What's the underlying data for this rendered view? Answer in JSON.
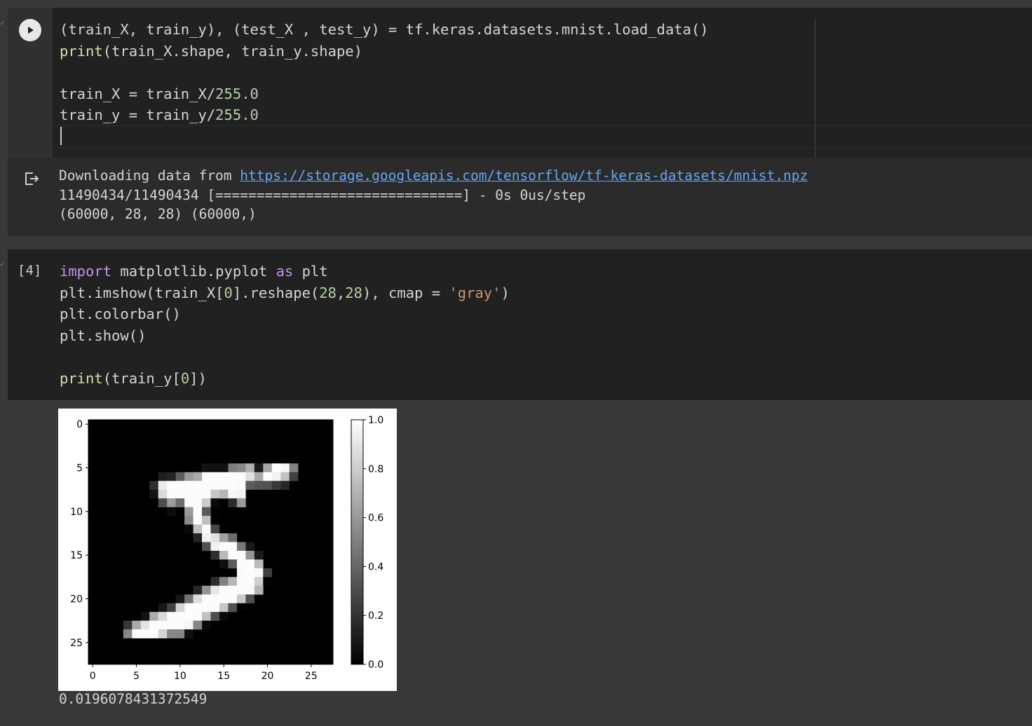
{
  "cell1": {
    "lines": [
      "(train_X, train_y), (test_X , test_y) = tf.keras.datasets.mnist.load_data()",
      "print(train_X.shape, train_y.shape)",
      "",
      "train_X = train_X/255.0",
      "train_y = train_y/255.0"
    ],
    "output": {
      "download_prefix": "Downloading data from ",
      "download_url": "https://storage.googleapis.com/tensorflow/tf-keras-datasets/mnist.npz",
      "progress_line": "11490434/11490434 [==============================] - 0s 0us/step",
      "shape_line": "(60000, 28, 28) (60000,)"
    }
  },
  "cell2": {
    "exec_count": "[4]",
    "lines": [
      "import matplotlib.pyplot as plt",
      "plt.imshow(train_X[0].reshape(28,28), cmap = 'gray')",
      "plt.colorbar()",
      "plt.show()",
      "",
      "print(train_y[0])"
    ],
    "print_output": "0.0196078431372549"
  },
  "chart_data": {
    "type": "heatmap",
    "title": "",
    "xlabel": "",
    "ylabel": "",
    "cmap": "gray",
    "x_ticks": [
      "0",
      "5",
      "10",
      "15",
      "20",
      "25"
    ],
    "y_ticks": [
      "0",
      "5",
      "10",
      "15",
      "20",
      "25"
    ],
    "colorbar_ticks": [
      "0.0",
      "0.2",
      "0.4",
      "0.6",
      "0.8",
      "1.0"
    ],
    "vmin": 0.0,
    "vmax": 1.0,
    "rows": 28,
    "cols": 28,
    "values": [
      [
        0,
        0,
        0,
        0,
        0,
        0,
        0,
        0,
        0,
        0,
        0,
        0,
        0,
        0,
        0,
        0,
        0,
        0,
        0,
        0,
        0,
        0,
        0,
        0,
        0,
        0,
        0,
        0
      ],
      [
        0,
        0,
        0,
        0,
        0,
        0,
        0,
        0,
        0,
        0,
        0,
        0,
        0,
        0,
        0,
        0,
        0,
        0,
        0,
        0,
        0,
        0,
        0,
        0,
        0,
        0,
        0,
        0
      ],
      [
        0,
        0,
        0,
        0,
        0,
        0,
        0,
        0,
        0,
        0,
        0,
        0,
        0,
        0,
        0,
        0,
        0,
        0,
        0,
        0,
        0,
        0,
        0,
        0,
        0,
        0,
        0,
        0
      ],
      [
        0,
        0,
        0,
        0,
        0,
        0,
        0,
        0,
        0,
        0,
        0,
        0,
        0,
        0,
        0,
        0,
        0,
        0,
        0,
        0,
        0,
        0,
        0,
        0,
        0,
        0,
        0,
        0
      ],
      [
        0,
        0,
        0,
        0,
        0,
        0,
        0,
        0,
        0,
        0,
        0,
        0,
        0,
        0,
        0,
        0,
        0,
        0,
        0,
        0,
        0,
        0,
        0,
        0,
        0,
        0,
        0,
        0
      ],
      [
        0,
        0,
        0,
        0,
        0,
        0,
        0,
        0,
        0,
        0,
        0,
        0,
        0.01,
        0.07,
        0.07,
        0.07,
        0.49,
        0.53,
        0.69,
        0.1,
        0.65,
        1,
        0.97,
        0.5,
        0,
        0,
        0,
        0
      ],
      [
        0,
        0,
        0,
        0,
        0,
        0,
        0,
        0,
        0.12,
        0.14,
        0.37,
        0.6,
        0.67,
        0.99,
        0.99,
        0.99,
        0.99,
        0.99,
        0.88,
        0.67,
        0.99,
        0.95,
        0.76,
        0.25,
        0,
        0,
        0,
        0
      ],
      [
        0,
        0,
        0,
        0,
        0,
        0,
        0,
        0.19,
        0.93,
        0.99,
        0.99,
        0.99,
        0.99,
        0.99,
        0.99,
        0.99,
        0.99,
        0.98,
        0.36,
        0.32,
        0.32,
        0.22,
        0.15,
        0,
        0,
        0,
        0,
        0
      ],
      [
        0,
        0,
        0,
        0,
        0,
        0,
        0,
        0.07,
        0.86,
        0.99,
        0.99,
        0.99,
        0.99,
        0.99,
        0.78,
        0.71,
        0.97,
        0.95,
        0,
        0,
        0,
        0,
        0,
        0,
        0,
        0,
        0,
        0
      ],
      [
        0,
        0,
        0,
        0,
        0,
        0,
        0,
        0,
        0.31,
        0.61,
        0.42,
        0.99,
        0.99,
        0.8,
        0.04,
        0,
        0.17,
        0.6,
        0,
        0,
        0,
        0,
        0,
        0,
        0,
        0,
        0,
        0
      ],
      [
        0,
        0,
        0,
        0,
        0,
        0,
        0,
        0,
        0,
        0.05,
        0,
        0.6,
        0.99,
        0.35,
        0,
        0,
        0,
        0,
        0,
        0,
        0,
        0,
        0,
        0,
        0,
        0,
        0,
        0
      ],
      [
        0,
        0,
        0,
        0,
        0,
        0,
        0,
        0,
        0,
        0,
        0,
        0.55,
        0.99,
        0.75,
        0.01,
        0,
        0,
        0,
        0,
        0,
        0,
        0,
        0,
        0,
        0,
        0,
        0,
        0
      ],
      [
        0,
        0,
        0,
        0,
        0,
        0,
        0,
        0,
        0,
        0,
        0,
        0.04,
        0.75,
        0.99,
        0.27,
        0,
        0,
        0,
        0,
        0,
        0,
        0,
        0,
        0,
        0,
        0,
        0,
        0
      ],
      [
        0,
        0,
        0,
        0,
        0,
        0,
        0,
        0,
        0,
        0,
        0,
        0,
        0.14,
        0.95,
        0.88,
        0.63,
        0.42,
        0,
        0,
        0,
        0,
        0,
        0,
        0,
        0,
        0,
        0,
        0
      ],
      [
        0,
        0,
        0,
        0,
        0,
        0,
        0,
        0,
        0,
        0,
        0,
        0,
        0,
        0.32,
        0.94,
        0.99,
        0.99,
        0.47,
        0.1,
        0,
        0,
        0,
        0,
        0,
        0,
        0,
        0,
        0
      ],
      [
        0,
        0,
        0,
        0,
        0,
        0,
        0,
        0,
        0,
        0,
        0,
        0,
        0,
        0,
        0.18,
        0.73,
        0.99,
        0.99,
        0.59,
        0.11,
        0,
        0,
        0,
        0,
        0,
        0,
        0,
        0
      ],
      [
        0,
        0,
        0,
        0,
        0,
        0,
        0,
        0,
        0,
        0,
        0,
        0,
        0,
        0,
        0,
        0.06,
        0.36,
        0.99,
        0.99,
        0.73,
        0,
        0,
        0,
        0,
        0,
        0,
        0,
        0
      ],
      [
        0,
        0,
        0,
        0,
        0,
        0,
        0,
        0,
        0,
        0,
        0,
        0,
        0,
        0,
        0,
        0,
        0,
        0.98,
        0.99,
        0.98,
        0.25,
        0,
        0,
        0,
        0,
        0,
        0,
        0
      ],
      [
        0,
        0,
        0,
        0,
        0,
        0,
        0,
        0,
        0,
        0,
        0,
        0,
        0,
        0,
        0.18,
        0.51,
        0.72,
        0.99,
        0.99,
        0.81,
        0.01,
        0,
        0,
        0,
        0,
        0,
        0,
        0
      ],
      [
        0,
        0,
        0,
        0,
        0,
        0,
        0,
        0,
        0,
        0,
        0,
        0,
        0.15,
        0.58,
        0.9,
        0.99,
        0.99,
        0.99,
        0.98,
        0.71,
        0,
        0,
        0,
        0,
        0,
        0,
        0,
        0
      ],
      [
        0,
        0,
        0,
        0,
        0,
        0,
        0,
        0,
        0,
        0,
        0.09,
        0.45,
        0.87,
        0.99,
        0.99,
        0.99,
        0.99,
        0.79,
        0.31,
        0,
        0,
        0,
        0,
        0,
        0,
        0,
        0,
        0
      ],
      [
        0,
        0,
        0,
        0,
        0,
        0,
        0,
        0,
        0.09,
        0.26,
        0.84,
        0.99,
        0.99,
        0.99,
        0.99,
        0.78,
        0.32,
        0.01,
        0,
        0,
        0,
        0,
        0,
        0,
        0,
        0,
        0,
        0
      ],
      [
        0,
        0,
        0,
        0,
        0,
        0,
        0.07,
        0.67,
        0.86,
        0.99,
        0.99,
        0.99,
        0.99,
        0.76,
        0.31,
        0.04,
        0,
        0,
        0,
        0,
        0,
        0,
        0,
        0,
        0,
        0,
        0,
        0
      ],
      [
        0,
        0,
        0,
        0,
        0.22,
        0.67,
        0.89,
        0.99,
        0.99,
        0.99,
        0.99,
        0.96,
        0.52,
        0.04,
        0,
        0,
        0,
        0,
        0,
        0,
        0,
        0,
        0,
        0,
        0,
        0,
        0,
        0
      ],
      [
        0,
        0,
        0,
        0,
        0.53,
        0.99,
        0.99,
        0.99,
        0.83,
        0.53,
        0.52,
        0.06,
        0,
        0,
        0,
        0,
        0,
        0,
        0,
        0,
        0,
        0,
        0,
        0,
        0,
        0,
        0,
        0
      ],
      [
        0,
        0,
        0,
        0,
        0,
        0,
        0,
        0,
        0,
        0,
        0,
        0,
        0,
        0,
        0,
        0,
        0,
        0,
        0,
        0,
        0,
        0,
        0,
        0,
        0,
        0,
        0,
        0
      ],
      [
        0,
        0,
        0,
        0,
        0,
        0,
        0,
        0,
        0,
        0,
        0,
        0,
        0,
        0,
        0,
        0,
        0,
        0,
        0,
        0,
        0,
        0,
        0,
        0,
        0,
        0,
        0,
        0
      ],
      [
        0,
        0,
        0,
        0,
        0,
        0,
        0,
        0,
        0,
        0,
        0,
        0,
        0,
        0,
        0,
        0,
        0,
        0,
        0,
        0,
        0,
        0,
        0,
        0,
        0,
        0,
        0,
        0
      ]
    ]
  }
}
